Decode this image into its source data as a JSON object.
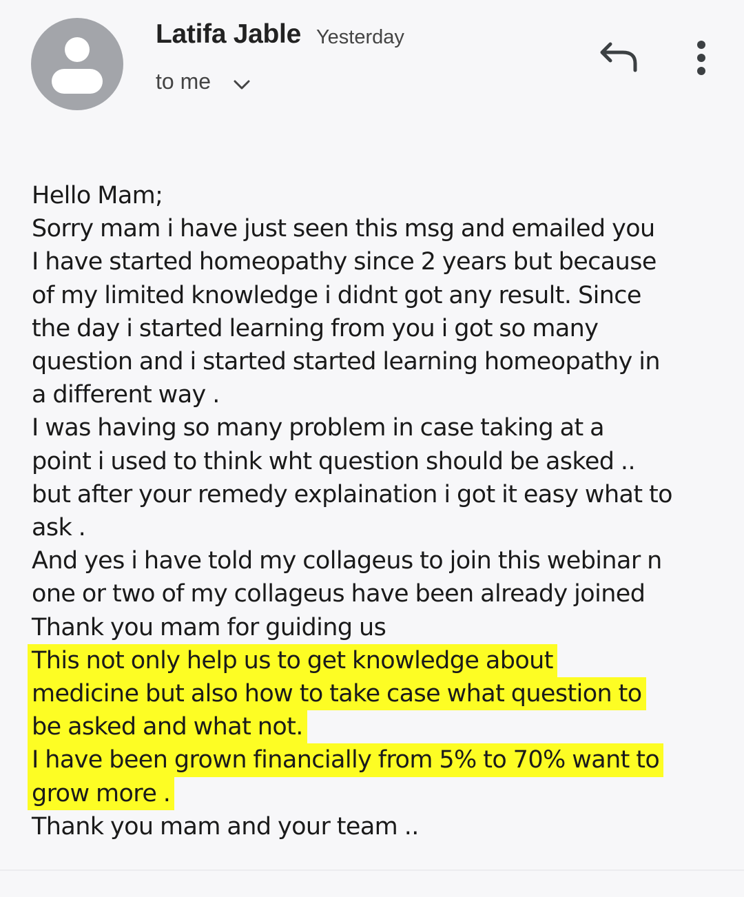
{
  "header": {
    "sender_name": "Latifa Jable",
    "time": "Yesterday",
    "recipient": "to me",
    "icons": {
      "avatar": "person-avatar-icon",
      "recipient_toggle": "chevron-down-icon",
      "reply": "reply-icon",
      "more": "more-vertical-icon"
    }
  },
  "message": {
    "highlight_color": "#fdfd24",
    "lines": [
      "Hello Mam;",
      "Sorry mam i have just seen this msg and emailed you",
      "I have started homeopathy since 2 years but because",
      "of my limited knowledge i didnt got any result. Since",
      "the day i started learning from you i got so many",
      "question  and i started started learning homeopathy in",
      "a different way .",
      "I was having so many problem in case taking at a",
      "point i used to think wht question should be asked ..",
      "but after your remedy explaination i got it easy what to",
      "ask .",
      "And yes i have told my collageus to join this webinar n",
      "one or two of my collageus have been already joined",
      "Thank you mam for guiding us",
      "This not only help us to get knowledge about",
      "medicine but also how to take case what question to",
      "be asked and what not.",
      "I have been grown financially from 5% to 70% want to",
      "grow more .",
      "Thank you mam and your team .."
    ]
  }
}
